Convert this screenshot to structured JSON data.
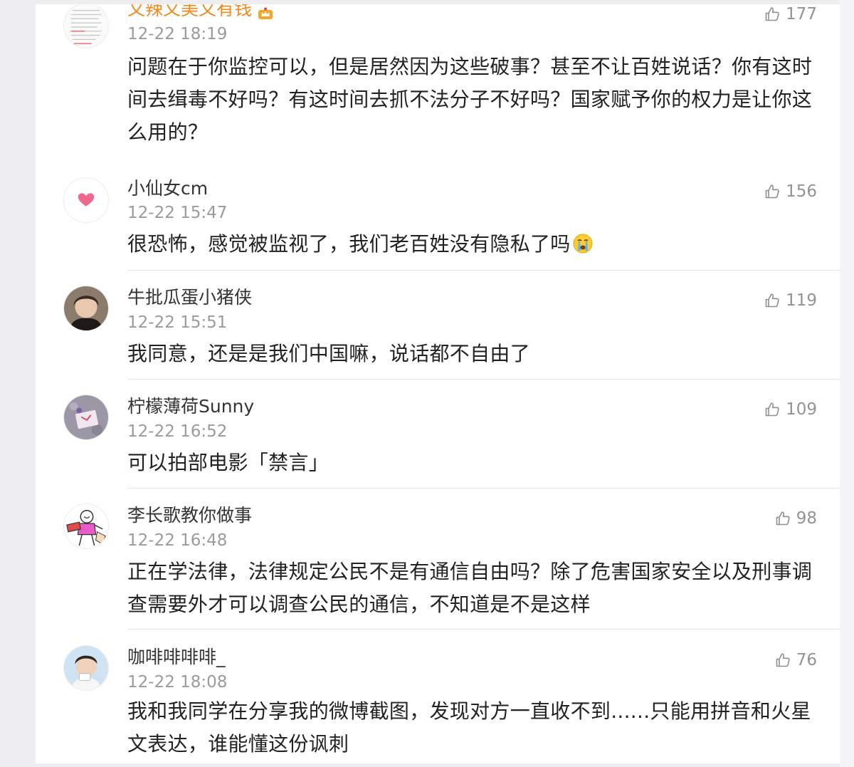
{
  "comments": [
    {
      "username": "又辣又美又有钱",
      "time": "12-22 18:19",
      "likes": "177",
      "text": "问题在于你监控可以，但是居然因为这些破事？甚至不让百姓说话？你有这时间去缉毒不好吗？有这时间去抓不法分子不好吗？国家赋予你的权力是让你这么用的？",
      "avatar_icon": "text-screenshot-avatar",
      "badge_icon": "vip-crown-icon"
    },
    {
      "username": "小仙女cm",
      "time": "12-22 15:47",
      "likes": "156",
      "text": "很恐怖，感觉被监视了，我们老百姓没有隐私了吗",
      "avatar_icon": "pink-heart-avatar",
      "trailing_emoji": "crying-face-emoji"
    },
    {
      "username": "牛批瓜蛋小猪侠",
      "time": "12-22 15:51",
      "likes": "119",
      "text": "我同意，还是是我们中国嘛，说话都不自由了",
      "avatar_icon": "person-photo-avatar"
    },
    {
      "username": "柠檬薄荷Sunny",
      "time": "12-22 16:52",
      "likes": "109",
      "text": "可以拍部电影「禁言」",
      "avatar_icon": "envelope-photo-avatar"
    },
    {
      "username": "李长歌教你做事",
      "time": "12-22 16:48",
      "likes": "98",
      "text": "正在学法律，法律规定公民不是有通信自由吗？除了危害国家安全以及刑事调查需要外才可以调查公民的通信，不知道是不是这样",
      "avatar_icon": "cartoon-character-avatar"
    },
    {
      "username": "咖啡啡啡啡_",
      "time": "12-22 18:08",
      "likes": "76",
      "text": "我和我同学在分享我的微博截图，发现对方一直收不到......只能用拼音和火星文表达，谁能懂这份讽刺",
      "avatar_icon": "boy-photo-avatar"
    }
  ],
  "colors": {
    "username": "#333333",
    "vip_username": "#f28a1b",
    "meta": "#9b9b9b",
    "body_text": "#222222",
    "divider": "#e6e6e6"
  }
}
